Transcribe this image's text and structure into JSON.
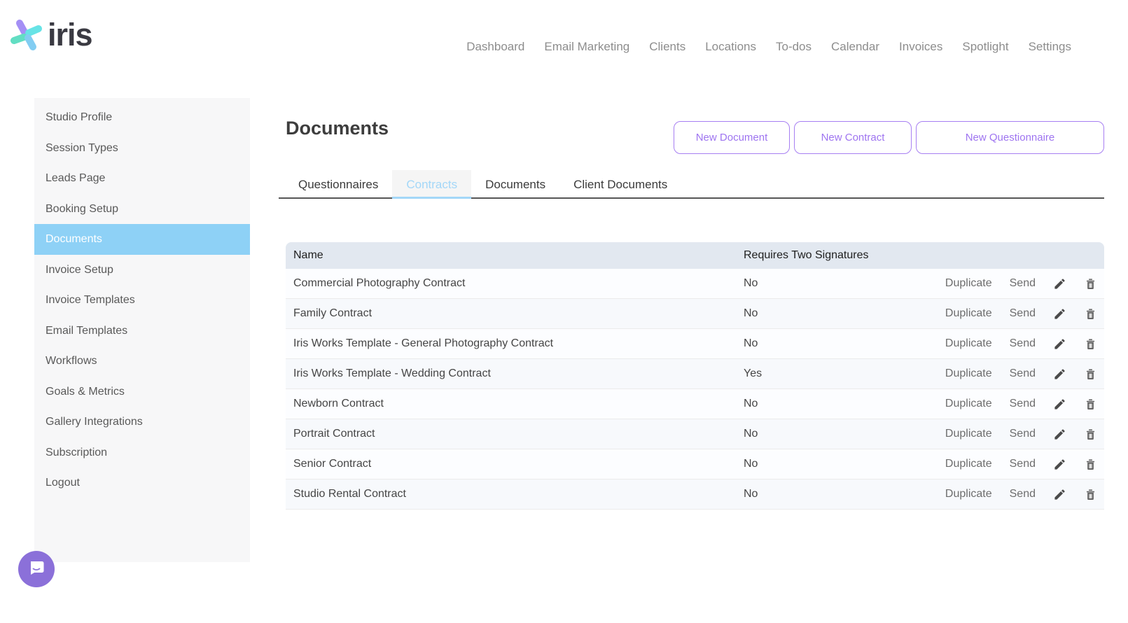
{
  "brand": {
    "name": "iris"
  },
  "nav": {
    "items": [
      "Dashboard",
      "Email Marketing",
      "Clients",
      "Locations",
      "To-dos",
      "Calendar",
      "Invoices",
      "Spotlight",
      "Settings"
    ]
  },
  "sidebar": {
    "items": [
      "Studio Profile",
      "Session Types",
      "Leads Page",
      "Booking Setup",
      "Documents",
      "Invoice Setup",
      "Invoice Templates",
      "Email Templates",
      "Workflows",
      "Goals & Metrics",
      "Gallery Integrations",
      "Subscription",
      "Logout"
    ],
    "active_item": "Documents"
  },
  "page": {
    "title": "Documents"
  },
  "buttons": {
    "new_document": "New Document",
    "new_contract": "New Contract",
    "new_questionnaire": "New Questionnaire"
  },
  "tabs": {
    "items": [
      "Questionnaires",
      "Contracts",
      "Documents",
      "Client Documents"
    ],
    "active": "Contracts"
  },
  "table": {
    "columns": {
      "name": "Name",
      "requires": "Requires Two Signatures"
    },
    "row_actions": {
      "duplicate": "Duplicate",
      "send": "Send"
    },
    "rows": [
      {
        "name": "Commercial Photography Contract",
        "requires": "No"
      },
      {
        "name": "Family Contract",
        "requires": "No"
      },
      {
        "name": "Iris Works Template - General Photography Contract",
        "requires": "No"
      },
      {
        "name": "Iris Works Template - Wedding Contract",
        "requires": "Yes"
      },
      {
        "name": "Newborn Contract",
        "requires": "No"
      },
      {
        "name": "Portrait Contract",
        "requires": "No"
      },
      {
        "name": "Senior Contract",
        "requires": "No"
      },
      {
        "name": "Studio Rental Contract",
        "requires": "No"
      }
    ]
  },
  "colors": {
    "accent_purple": "#a77ff2",
    "sidebar_active_blue": "#8ed1f6",
    "tab_active_blue": "#a3d7f8",
    "table_header_bg": "#e2e8f0",
    "chat_bubble_purple": "#8b70d9",
    "logo_purple": "#a48ff5",
    "logo_cyan": "#67e3e6",
    "logo_teal": "#62dec3",
    "logo_blue": "#82cdf2"
  }
}
